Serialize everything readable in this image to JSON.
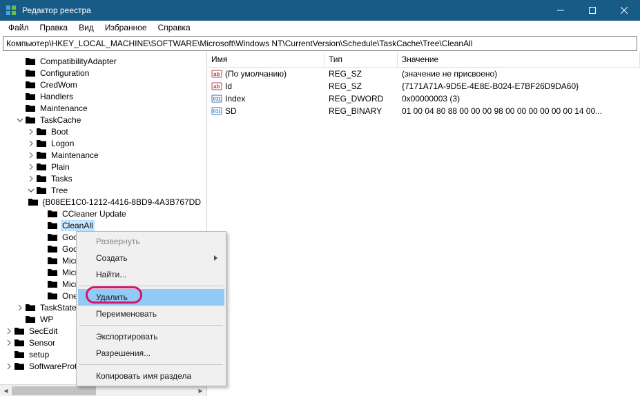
{
  "window": {
    "title": "Редактор реестра"
  },
  "menu": {
    "file": "Файл",
    "edit": "Правка",
    "view": "Вид",
    "favorites": "Избранное",
    "help": "Справка"
  },
  "address": "Компьютер\\HKEY_LOCAL_MACHINE\\SOFTWARE\\Microsoft\\Windows NT\\CurrentVersion\\Schedule\\TaskCache\\Tree\\CleanAll",
  "list": {
    "cols": {
      "name": "Имя",
      "type": "Тип",
      "value": "Значение"
    },
    "rows": [
      {
        "icon": "string",
        "name": "(По умолчанию)",
        "type": "REG_SZ",
        "value": "(значение не присвоено)"
      },
      {
        "icon": "string",
        "name": "Id",
        "type": "REG_SZ",
        "value": "{7171A71A-9D5E-4E8E-B024-E7BF26D9DA60}"
      },
      {
        "icon": "binary",
        "name": "Index",
        "type": "REG_DWORD",
        "value": "0x00000003 (3)"
      },
      {
        "icon": "binary",
        "name": "SD",
        "type": "REG_BINARY",
        "value": "01 00 04 80 88 00 00 00 98 00 00 00 00 00 00 14 00..."
      }
    ]
  },
  "tree": [
    {
      "d": 1,
      "exp": "leaf",
      "label": "CompatibilityAdapter"
    },
    {
      "d": 1,
      "exp": "leaf",
      "label": "Configuration"
    },
    {
      "d": 1,
      "exp": "leaf",
      "label": "CredWom"
    },
    {
      "d": 1,
      "exp": "leaf",
      "label": "Handlers"
    },
    {
      "d": 1,
      "exp": "leaf",
      "label": "Maintenance"
    },
    {
      "d": 1,
      "exp": "open",
      "label": "TaskCache"
    },
    {
      "d": 2,
      "exp": "closed",
      "label": "Boot"
    },
    {
      "d": 2,
      "exp": "closed",
      "label": "Logon"
    },
    {
      "d": 2,
      "exp": "closed",
      "label": "Maintenance"
    },
    {
      "d": 2,
      "exp": "closed",
      "label": "Plain"
    },
    {
      "d": 2,
      "exp": "closed",
      "label": "Tasks"
    },
    {
      "d": 2,
      "exp": "open",
      "label": "Tree"
    },
    {
      "d": 3,
      "exp": "leaf",
      "label": "{B08EE1C0-1212-4416-8BD9-4A3B767DD"
    },
    {
      "d": 3,
      "exp": "leaf",
      "label": "CCleaner Update"
    },
    {
      "d": 3,
      "exp": "leaf",
      "label": "CleanAll",
      "selected": true
    },
    {
      "d": 3,
      "exp": "leaf",
      "label": "Google"
    },
    {
      "d": 3,
      "exp": "leaf",
      "label": "Google"
    },
    {
      "d": 3,
      "exp": "leaf",
      "label": "Micros"
    },
    {
      "d": 3,
      "exp": "leaf",
      "label": "Micros"
    },
    {
      "d": 3,
      "exp": "leaf",
      "label": "Micros"
    },
    {
      "d": 3,
      "exp": "leaf",
      "label": "OneDri"
    },
    {
      "d": 1,
      "exp": "closed",
      "label": "TaskStateFlag"
    },
    {
      "d": 1,
      "exp": "leaf",
      "label": "WP"
    },
    {
      "d": 0,
      "exp": "closed",
      "label": "SecEdit"
    },
    {
      "d": 0,
      "exp": "closed",
      "label": "Sensor"
    },
    {
      "d": 0,
      "exp": "leaf",
      "label": "setup"
    },
    {
      "d": 0,
      "exp": "closed",
      "label": "SoftwareProtectionPlatform"
    }
  ],
  "ctx": {
    "expand": "Развернуть",
    "new": "Создать",
    "find": "Найти...",
    "delete": "Удалить",
    "rename": "Переименовать",
    "export": "Экспортировать",
    "permissions": "Разрешения...",
    "copykey": "Копировать имя раздела"
  }
}
